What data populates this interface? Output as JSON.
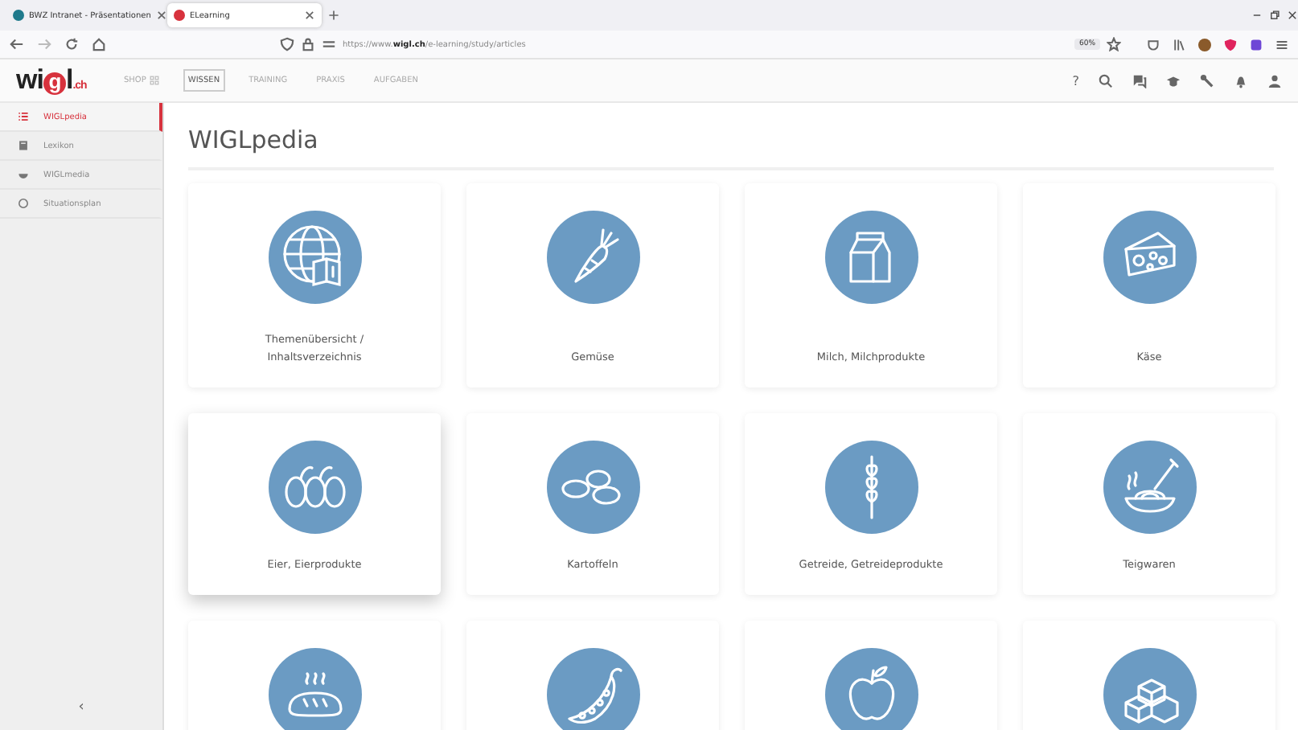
{
  "browser": {
    "tabs": [
      {
        "title": "BWZ Intranet - Präsentationen",
        "selected": false
      },
      {
        "title": "ELearning",
        "selected": true
      }
    ],
    "url": {
      "host": "https://www.**wigl.ch**/e-learning/study/articles"
    },
    "zoom": "60%"
  },
  "site": {
    "logo": "wigl.ch",
    "nav": [
      {
        "label": "SHOP",
        "selected": false
      },
      {
        "label": "WISSEN",
        "selected": true
      },
      {
        "label": "TRAINING",
        "selected": false
      },
      {
        "label": "PRAXIS",
        "selected": false
      },
      {
        "label": "AUFGABEN",
        "selected": false
      }
    ],
    "help": "?"
  },
  "sidebar": {
    "items": [
      {
        "label": "WIGLpedia",
        "selected": true
      },
      {
        "label": "Lexikon",
        "selected": false
      },
      {
        "label": "WIGLmedia",
        "selected": false
      },
      {
        "label": "Situationsplan",
        "selected": false
      }
    ],
    "collapse": "‹"
  },
  "page": {
    "title": "WIGLpedia",
    "cards": [
      {
        "kind": "full",
        "label": "Themenübersicht / Inhaltsverzeichnis",
        "hovered": false
      },
      {
        "kind": "full",
        "label": "Gemüse",
        "hovered": false
      },
      {
        "kind": "full",
        "label": "Milch, Milchprodukte",
        "hovered": false
      },
      {
        "kind": "full",
        "label": "Käse",
        "hovered": false
      },
      {
        "kind": "full",
        "label": "Eier, Eierprodukte",
        "hovered": true
      },
      {
        "kind": "full",
        "label": "Kartoffeln",
        "hovered": false
      },
      {
        "kind": "full",
        "label": "Getreide, Getreideprodukte",
        "hovered": false
      },
      {
        "kind": "full",
        "label": "Teigwaren",
        "hovered": false
      },
      {
        "kind": "partial",
        "hovered": false
      },
      {
        "kind": "partial",
        "hovered": false
      },
      {
        "kind": "partial",
        "hovered": false
      },
      {
        "kind": "partial",
        "hovered": false
      }
    ]
  }
}
